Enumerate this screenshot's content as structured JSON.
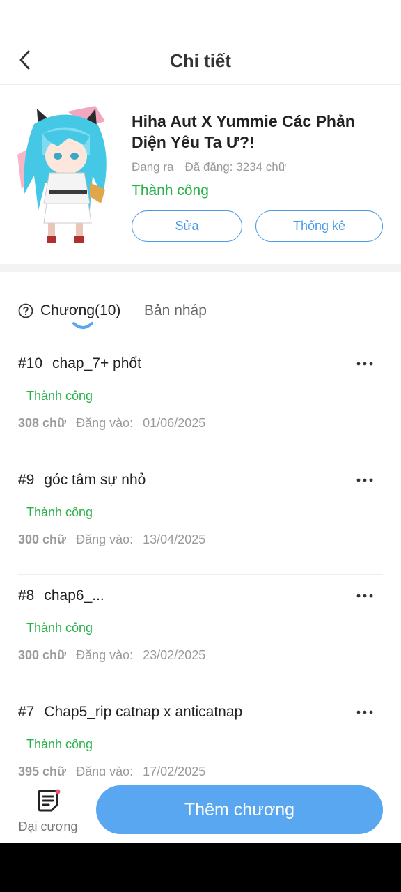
{
  "header": {
    "title": "Chi tiết"
  },
  "book": {
    "title": "Hiha Aut X Yummie Các Phản Diện Yêu Ta Ư?!",
    "state": "Đang ra",
    "posted_words": "Đã đăng: 3234 chữ",
    "status": "Thành công",
    "edit_label": "Sửa",
    "stats_label": "Thống kê"
  },
  "tabs": {
    "chapters_label": "Chương(10)",
    "drafts_label": "Bản nháp"
  },
  "chapters": [
    {
      "number": "#10",
      "title": "chap_7+ phốt",
      "status": "Thành công",
      "words": "308 chữ",
      "date_label": "Đăng vào:",
      "date": "01/06/2025"
    },
    {
      "number": "#9",
      "title": "góc tâm sự nhỏ",
      "status": "Thành công",
      "words": "300 chữ",
      "date_label": "Đăng vào:",
      "date": "13/04/2025"
    },
    {
      "number": "#8",
      "title": "chap6_...",
      "status": "Thành công",
      "words": "300 chữ",
      "date_label": "Đăng vào:",
      "date": "23/02/2025"
    },
    {
      "number": "#7",
      "title": "Chap5_rip catnap x anticatnap",
      "status": "Thành công",
      "words": "395 chữ",
      "date_label": "Đăng vào:",
      "date": "17/02/2025"
    }
  ],
  "bottom": {
    "outline_label": "Đại cương",
    "add_chapter_label": "Thêm chương"
  },
  "icons": {
    "back": "chevron-left-icon",
    "help": "question-circle-icon",
    "more": "more-horizontal-icon",
    "outline": "document-list-icon"
  },
  "colors": {
    "accent_blue": "#4a9ae8",
    "primary_button": "#5aa7f1",
    "success_green": "#2ab24b",
    "notification_dot": "#f0506e"
  }
}
